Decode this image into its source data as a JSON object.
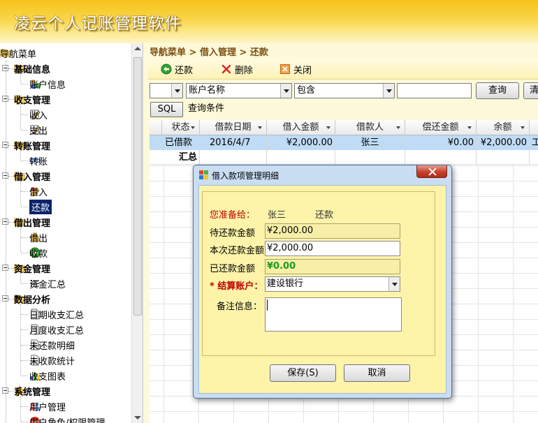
{
  "app": {
    "title": "凌云个人记账管理软件"
  },
  "sidebar": {
    "root_label": "导航菜单",
    "groups": [
      {
        "label": "基础信息",
        "items": [
          {
            "label": "账户信息",
            "icon": "account-icon"
          }
        ]
      },
      {
        "label": "收支管理",
        "items": [
          {
            "label": "收入",
            "icon": "edit-icon"
          },
          {
            "label": "支出",
            "icon": "edit-icon"
          }
        ]
      },
      {
        "label": "转账管理",
        "items": [
          {
            "label": "转账",
            "icon": "link-icon"
          }
        ]
      },
      {
        "label": "借入管理",
        "items": [
          {
            "label": "借入",
            "icon": "borrow-icon"
          },
          {
            "label": "还款",
            "icon": "green-arrow-icon",
            "selected": true
          }
        ]
      },
      {
        "label": "借出管理",
        "items": [
          {
            "label": "借出",
            "icon": "lend-icon"
          },
          {
            "label": "收款",
            "icon": "green-arrow-icon"
          }
        ]
      },
      {
        "label": "资金管理",
        "items": [
          {
            "label": "资金汇总",
            "icon": "list-icon"
          }
        ]
      },
      {
        "label": "数据分析",
        "items": [
          {
            "label": "日期收支汇总",
            "icon": "doc-icon"
          },
          {
            "label": "月度收支汇总",
            "icon": "doc-icon"
          },
          {
            "label": "未还款明细",
            "icon": "doc-icon"
          },
          {
            "label": "未收款统计",
            "icon": "doc-icon"
          },
          {
            "label": "收支图表",
            "icon": "chart-icon"
          }
        ]
      },
      {
        "label": "系统管理",
        "items": [
          {
            "label": "用户管理",
            "icon": "users-icon"
          },
          {
            "label": "用户角色/权限管理",
            "icon": "role-icon"
          }
        ]
      }
    ]
  },
  "main": {
    "breadcrumb": "导航菜单 > 借入管理 > 还款",
    "toolbar": {
      "repay_label": "还款",
      "delete_label": "删除",
      "close_label": "关闭"
    },
    "query": {
      "logic_value": "",
      "field_value": "账户名称",
      "operator_value": "包含",
      "keyword_value": "",
      "query_button": "查询",
      "clear_button": "清",
      "sql_button": "SQL",
      "condition_label": "查询条件"
    },
    "grid": {
      "columns": [
        "状态",
        "借款日期",
        "借入金额",
        "借款人",
        "偿还金额",
        "余额"
      ],
      "rows": [
        {
          "status": "已借款",
          "date": "2016/4/7",
          "amount": "¥2,000.00",
          "lender": "张三",
          "repaid": "¥0.00",
          "balance": "¥2,000.00",
          "extra": "工商"
        }
      ],
      "summary_label": "汇总"
    }
  },
  "dialog": {
    "title": "借入款项管理明细",
    "lender_label": "您准备给：",
    "lender_name": "张三",
    "action_label": "还款",
    "pending_label": "待还款金额",
    "pending_value": "¥2,000.00",
    "current_label": "本次还款金额",
    "current_value": "¥2,000.00",
    "repaid_label": "已还款金额",
    "repaid_value": "¥0.00",
    "account_label": "* 结算账户：",
    "account_value": "建设银行",
    "note_label": "备注信息：",
    "note_value": "",
    "save_button": "保存(S)",
    "cancel_button": "取消"
  },
  "colors": {
    "header_yellow": "#f6c21a",
    "panel_yellow": "#fef9d8",
    "dialog_yellow": "#fdf4a9",
    "selected_nav": "#0a246a",
    "required_red": "#c00000",
    "repaid_green": "#1a9a1a"
  }
}
